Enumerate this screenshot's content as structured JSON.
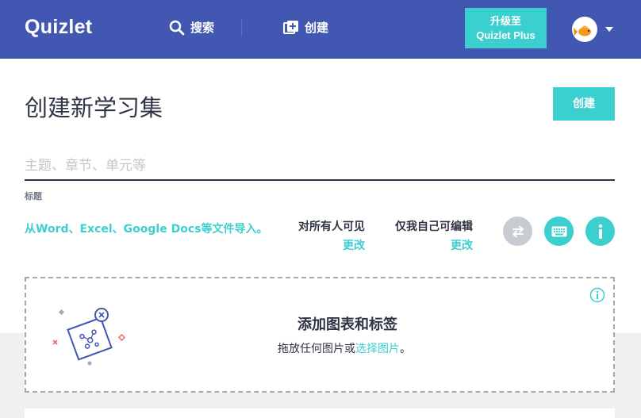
{
  "header": {
    "logo": "Quizlet",
    "search_label": "搜索",
    "create_label": "创建",
    "upgrade_line1": "升级至",
    "upgrade_line2": "Quizlet Plus"
  },
  "main": {
    "page_title": "创建新学习集",
    "create_button": "创建",
    "title_placeholder": "主题、章节、单元等",
    "title_field_label": "标题",
    "import_link": "从Word、Excel、Google Docs等文件导入。",
    "visible_to": {
      "label": "对所有人可见",
      "change": "更改"
    },
    "editable_by": {
      "label": "仅我自己可编辑",
      "change": "更改"
    }
  },
  "dropzone": {
    "title": "添加图表和标签",
    "sub_prefix": "拖放任何图片或",
    "sub_link": "选择图片",
    "sub_suffix": "。"
  },
  "colors": {
    "header_bg": "#4257b2",
    "accent": "#3ccfcf",
    "text_dark": "#303545"
  },
  "icons": [
    "search-icon",
    "add-set-icon",
    "avatar-goldfish-icon",
    "chevron-down-icon",
    "swap-icon",
    "keyboard-icon",
    "info-icon",
    "diagram-illustration"
  ]
}
